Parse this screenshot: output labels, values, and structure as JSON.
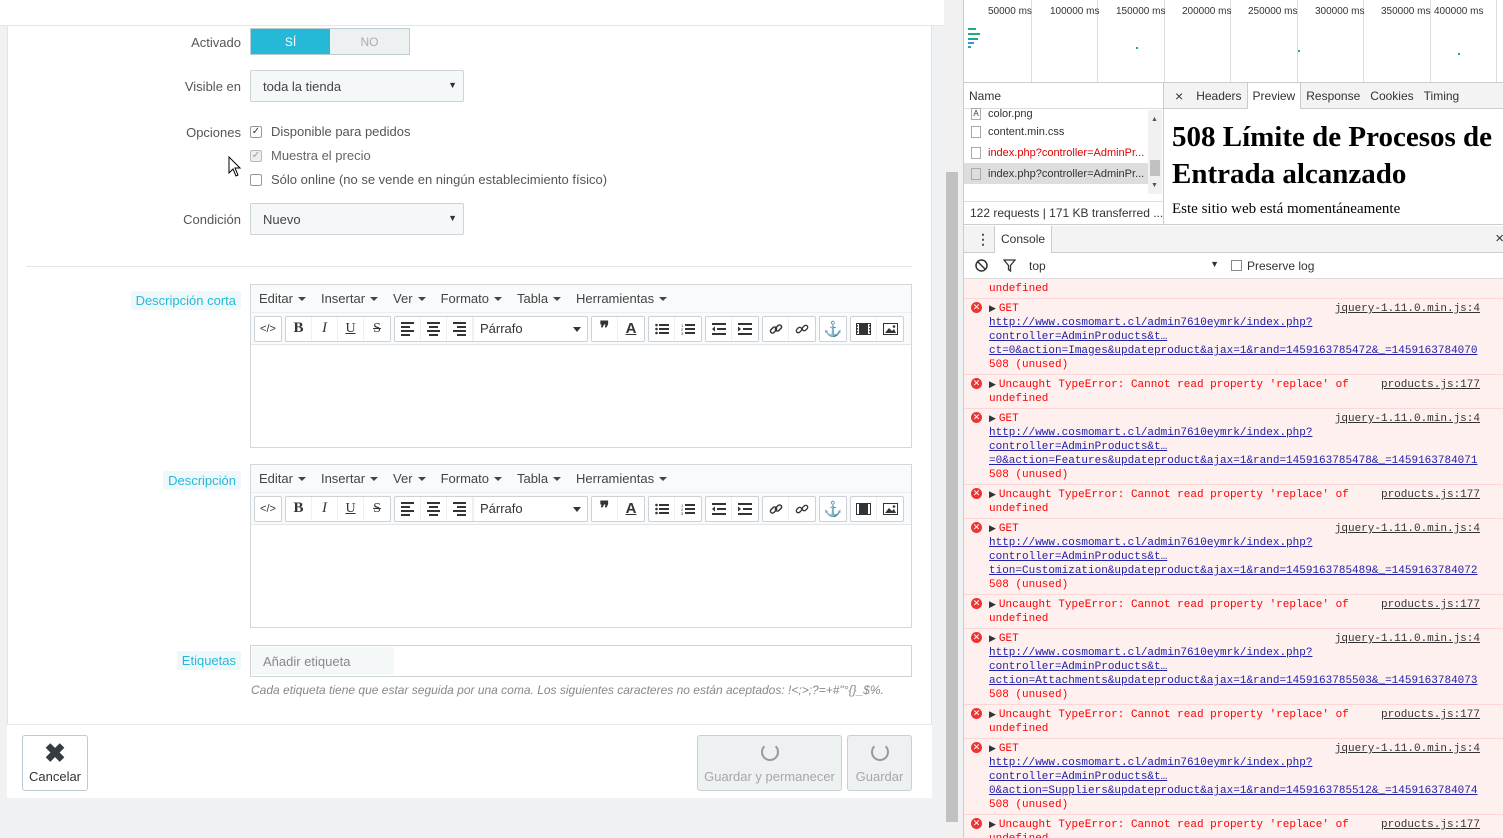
{
  "form": {
    "activado_label": "Activado",
    "switch_on": "SÍ",
    "switch_off": "NO",
    "visible_label": "Visible en",
    "visible_value": "toda la tienda",
    "opciones_label": "Opciones",
    "opt1": "Disponible para pedidos",
    "opt2": "Muestra el precio",
    "opt3": "Sólo online (no se vende en ningún establecimiento físico)",
    "condicion_label": "Condición",
    "condicion_value": "Nuevo",
    "desc_corta_label": "Descripción corta",
    "desc_label": "Descripción",
    "etiquetas_label": "Etiquetas",
    "tags_placeholder": "Añadir etiqueta",
    "help": "Cada etiqueta tiene que estar seguida por una coma. Los siguientes caracteres no están aceptados: !<;>;?=+#\"°{}_$%."
  },
  "editor": {
    "menus": [
      "Editar",
      "Insertar",
      "Ver",
      "Formato",
      "Tabla",
      "Herramientas"
    ],
    "format_value": "Párrafo",
    "code_glyph": "</>",
    "bold_glyph": "B",
    "italic_glyph": "I",
    "underline_glyph": "U",
    "strike_glyph": "S",
    "quote_glyph": "❞",
    "color_glyph": "A"
  },
  "footer": {
    "cancel": "Cancelar",
    "save_stay": "Guardar y permanecer",
    "save": "Guardar"
  },
  "devtools": {
    "timeline_ticks": [
      "50000 ms",
      "100000 ms",
      "150000 ms",
      "200000 ms",
      "250000 ms",
      "300000 ms",
      "350000 ms",
      "400000 ms"
    ],
    "name_header": "Name",
    "files": [
      {
        "name": "color.png",
        "error": false
      },
      {
        "name": "content.min.css",
        "error": false
      },
      {
        "name": "index.php?controller=AdminPr...",
        "error": true
      },
      {
        "name": "index.php?controller=AdminPr...",
        "error": false
      }
    ],
    "summary": "122 requests  |  171 KB transferred  ...",
    "preview_tabs": [
      "Headers",
      "Preview",
      "Response",
      "Cookies",
      "Timing"
    ],
    "preview_title": "508 Límite de Procesos de Entrada alcanzado",
    "preview_text": "Este sitio web está momentáneamente",
    "console_tab": "Console",
    "context": "top",
    "preserve_log": "Preserve log",
    "top_partial": "undefined",
    "messages": [
      {
        "kind": "get",
        "head": "GET",
        "src": "jquery-1.11.0.min.js:4",
        "url1": "http://www.cosmomart.cl/admin7610eymrk/index.php?",
        "url2": "controller=AdminProducts&t…",
        "url3": "ct=0&action=Images&updateproduct&ajax=1&rand=1459163785472&_=1459163784070",
        "tail": "508 (unused)"
      },
      {
        "kind": "err",
        "head": "Uncaught TypeError: Cannot read property 'replace' of",
        "src": "products.js:177",
        "tail": "undefined"
      },
      {
        "kind": "get",
        "head": "GET",
        "src": "jquery-1.11.0.min.js:4",
        "url1": "http://www.cosmomart.cl/admin7610eymrk/index.php?",
        "url2": "controller=AdminProducts&t…",
        "url3": "=0&action=Features&updateproduct&ajax=1&rand=1459163785478&_=1459163784071",
        "tail": "508 (unused)"
      },
      {
        "kind": "err",
        "head": "Uncaught TypeError: Cannot read property 'replace' of",
        "src": "products.js:177",
        "tail": "undefined"
      },
      {
        "kind": "get",
        "head": "GET",
        "src": "jquery-1.11.0.min.js:4",
        "url1": "http://www.cosmomart.cl/admin7610eymrk/index.php?",
        "url2": "controller=AdminProducts&t…",
        "url3": "tion=Customization&updateproduct&ajax=1&rand=1459163785489&_=1459163784072",
        "tail": "508 (unused)"
      },
      {
        "kind": "err",
        "head": "Uncaught TypeError: Cannot read property 'replace' of",
        "src": "products.js:177",
        "tail": "undefined"
      },
      {
        "kind": "get",
        "head": "GET",
        "src": "jquery-1.11.0.min.js:4",
        "url1": "http://www.cosmomart.cl/admin7610eymrk/index.php?",
        "url2": "controller=AdminProducts&t…",
        "url3": "action=Attachments&updateproduct&ajax=1&rand=1459163785503&_=1459163784073",
        "tail": "508 (unused)"
      },
      {
        "kind": "err",
        "head": "Uncaught TypeError: Cannot read property 'replace' of",
        "src": "products.js:177",
        "tail": "undefined"
      },
      {
        "kind": "get",
        "head": "GET",
        "src": "jquery-1.11.0.min.js:4",
        "url1": "http://www.cosmomart.cl/admin7610eymrk/index.php?",
        "url2": "controller=AdminProducts&t…",
        "url3": "0&action=Suppliers&updateproduct&ajax=1&rand=1459163785512&_=1459163784074",
        "tail": "508 (unused)"
      },
      {
        "kind": "err",
        "head": "Uncaught TypeError: Cannot read property 'replace' of",
        "src": "products.js:177",
        "tail": "undefined"
      }
    ]
  }
}
